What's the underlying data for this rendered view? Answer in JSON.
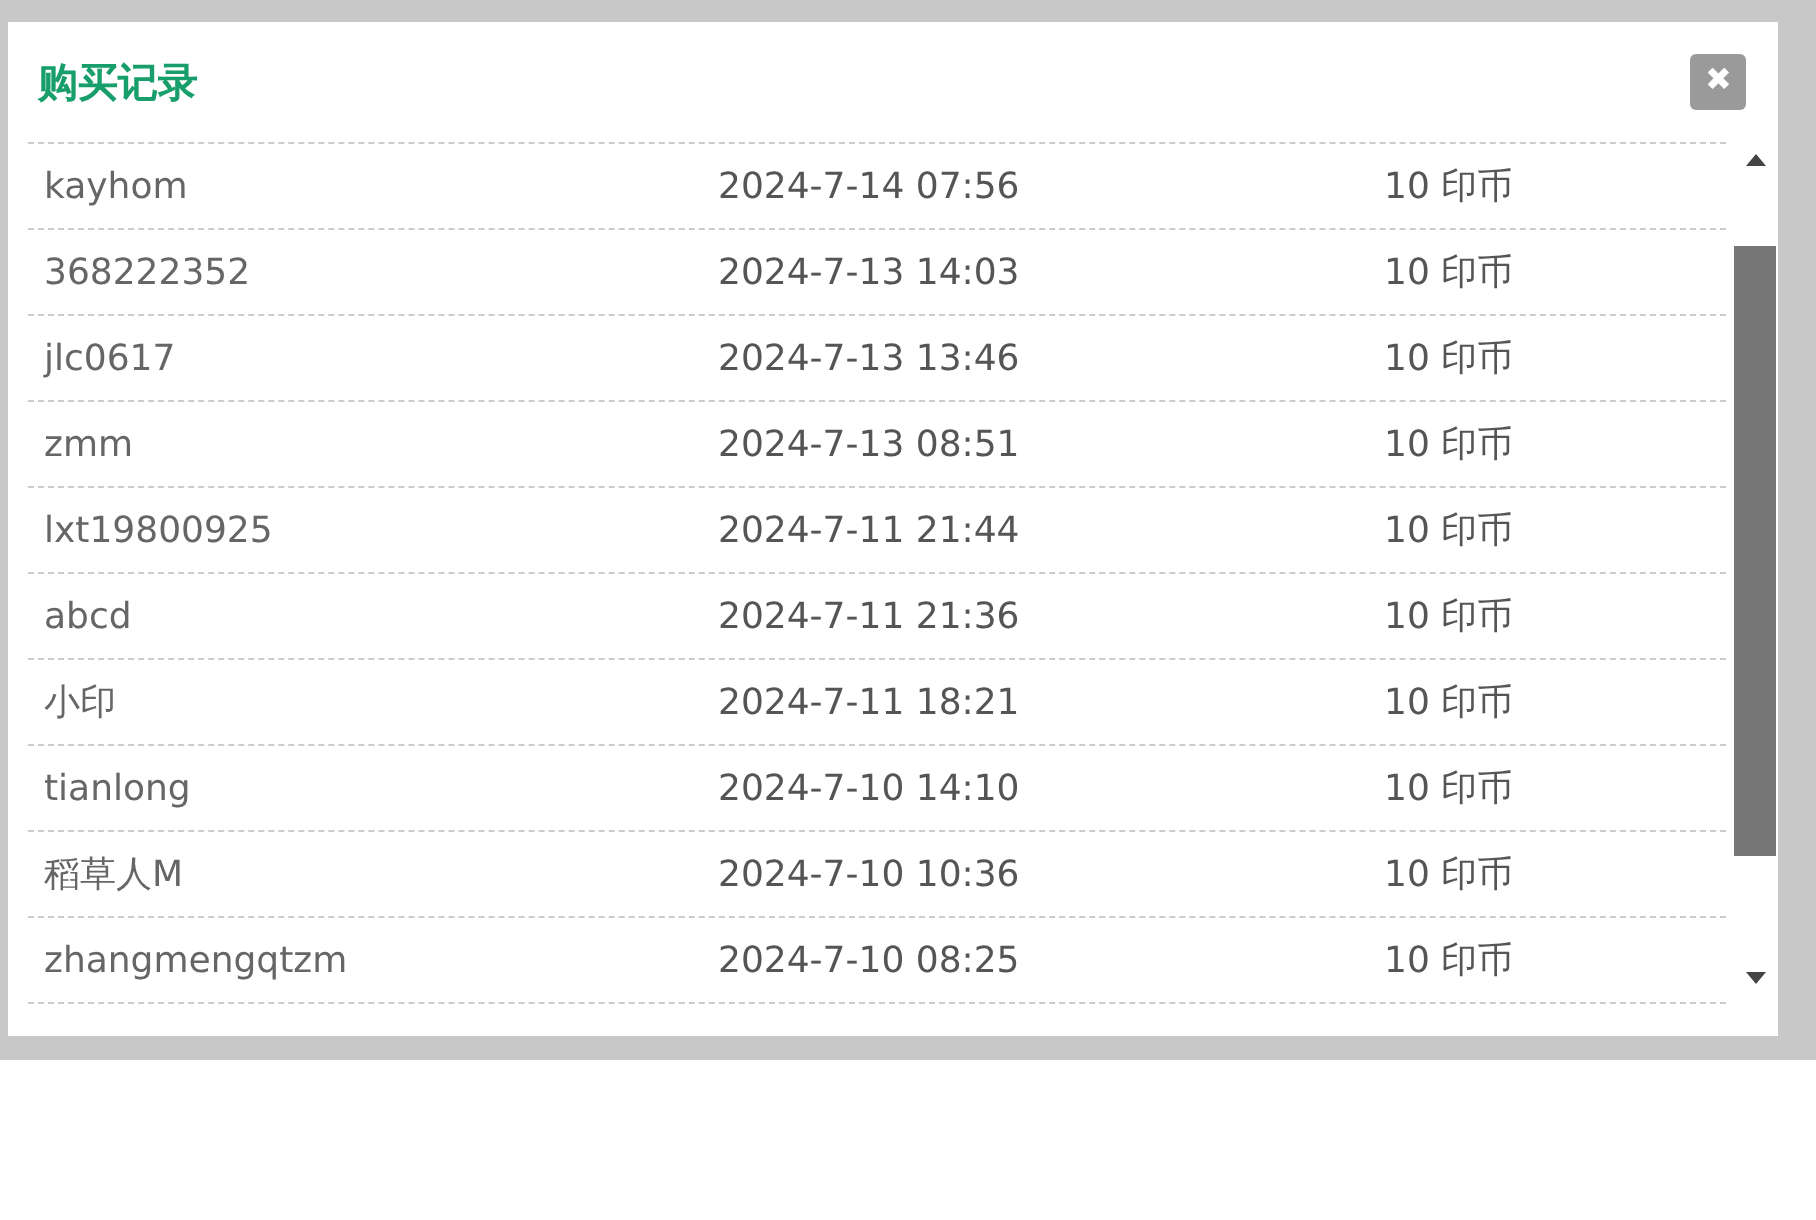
{
  "dialog": {
    "title": "购买记录",
    "close": "✖"
  },
  "records": [
    {
      "user": "kayhom",
      "time": "2024-7-14 07:56",
      "amount": "10 印币"
    },
    {
      "user": "368222352",
      "time": "2024-7-13 14:03",
      "amount": "10 印币"
    },
    {
      "user": "jlc0617",
      "time": "2024-7-13 13:46",
      "amount": "10 印币"
    },
    {
      "user": "zmm",
      "time": "2024-7-13 08:51",
      "amount": "10 印币"
    },
    {
      "user": "lxt19800925",
      "time": "2024-7-11 21:44",
      "amount": "10 印币"
    },
    {
      "user": "abcd",
      "time": "2024-7-11 21:36",
      "amount": "10 印币"
    },
    {
      "user": "小印",
      "time": "2024-7-11 18:21",
      "amount": "10 印币"
    },
    {
      "user": "tianlong",
      "time": "2024-7-10 14:10",
      "amount": "10 印币"
    },
    {
      "user": "稻草人M",
      "time": "2024-7-10 10:36",
      "amount": "10 印币"
    },
    {
      "user": "zhangmengqtzm",
      "time": "2024-7-10 08:25",
      "amount": "10 印币"
    }
  ]
}
